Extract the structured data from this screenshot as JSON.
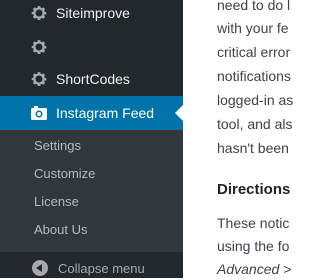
{
  "sidebar": {
    "items": [
      {
        "label": "Siteimprove",
        "icon": "gear-icon"
      },
      {
        "label": "",
        "icon": "gear-icon"
      },
      {
        "label": "ShortCodes",
        "icon": "gear-icon"
      },
      {
        "label": "Instagram Feed",
        "icon": "camera-icon",
        "active": true
      }
    ],
    "submenu": [
      "Settings",
      "Customize",
      "License",
      "About Us"
    ],
    "collapse_label": "Collapse menu"
  },
  "content": {
    "lines": [
      "need to do l",
      "with your fe",
      "critical error",
      "notifications",
      "logged-in as",
      "tool, and als",
      "hasn't been"
    ],
    "heading": "Directions",
    "paragraph_lines": [
      "These notic",
      "using the fo",
      "Advanced >"
    ]
  },
  "colors": {
    "sidebar_bg": "#23282d",
    "submenu_bg": "#32373c",
    "active_bg": "#0073aa"
  }
}
